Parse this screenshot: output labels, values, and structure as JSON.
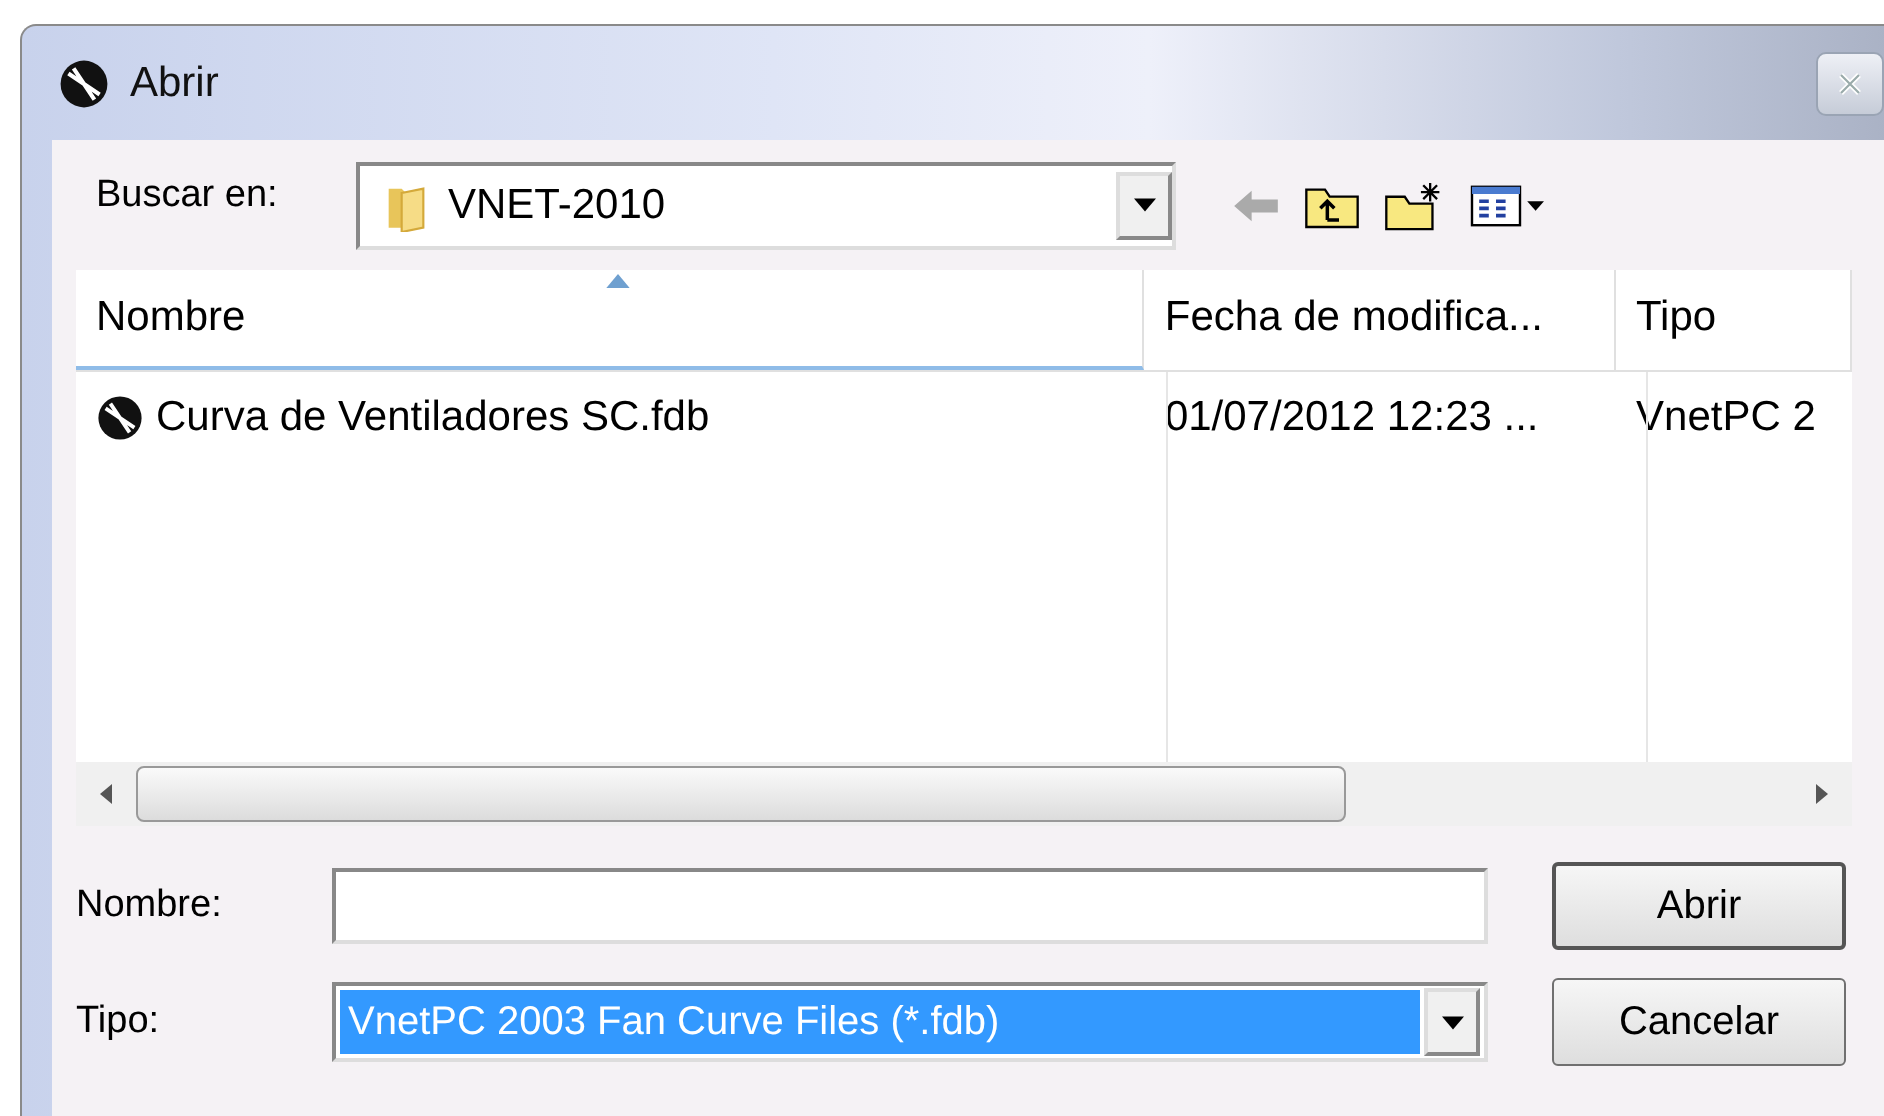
{
  "window": {
    "title": "Abrir"
  },
  "look_in": {
    "label": "Buscar en:",
    "value": "VNET-2010"
  },
  "list": {
    "columns": [
      {
        "label": "Nombre",
        "sorted": true
      },
      {
        "label": "Fecha de modifica...",
        "sorted": false
      },
      {
        "label": "Tipo",
        "sorted": false
      }
    ],
    "rows": [
      {
        "cells": [
          "Curva de Ventiladores SC.fdb",
          "01/07/2012 12:23 ...",
          "VnetPC 2"
        ]
      }
    ]
  },
  "file_name": {
    "label": "Nombre:"
  },
  "file_type": {
    "label": "Tipo:",
    "value": "VnetPC 2003 Fan Curve Files (*.fdb)",
    "selected": true
  },
  "buttons": [
    "Abrir",
    "Cancelar"
  ]
}
